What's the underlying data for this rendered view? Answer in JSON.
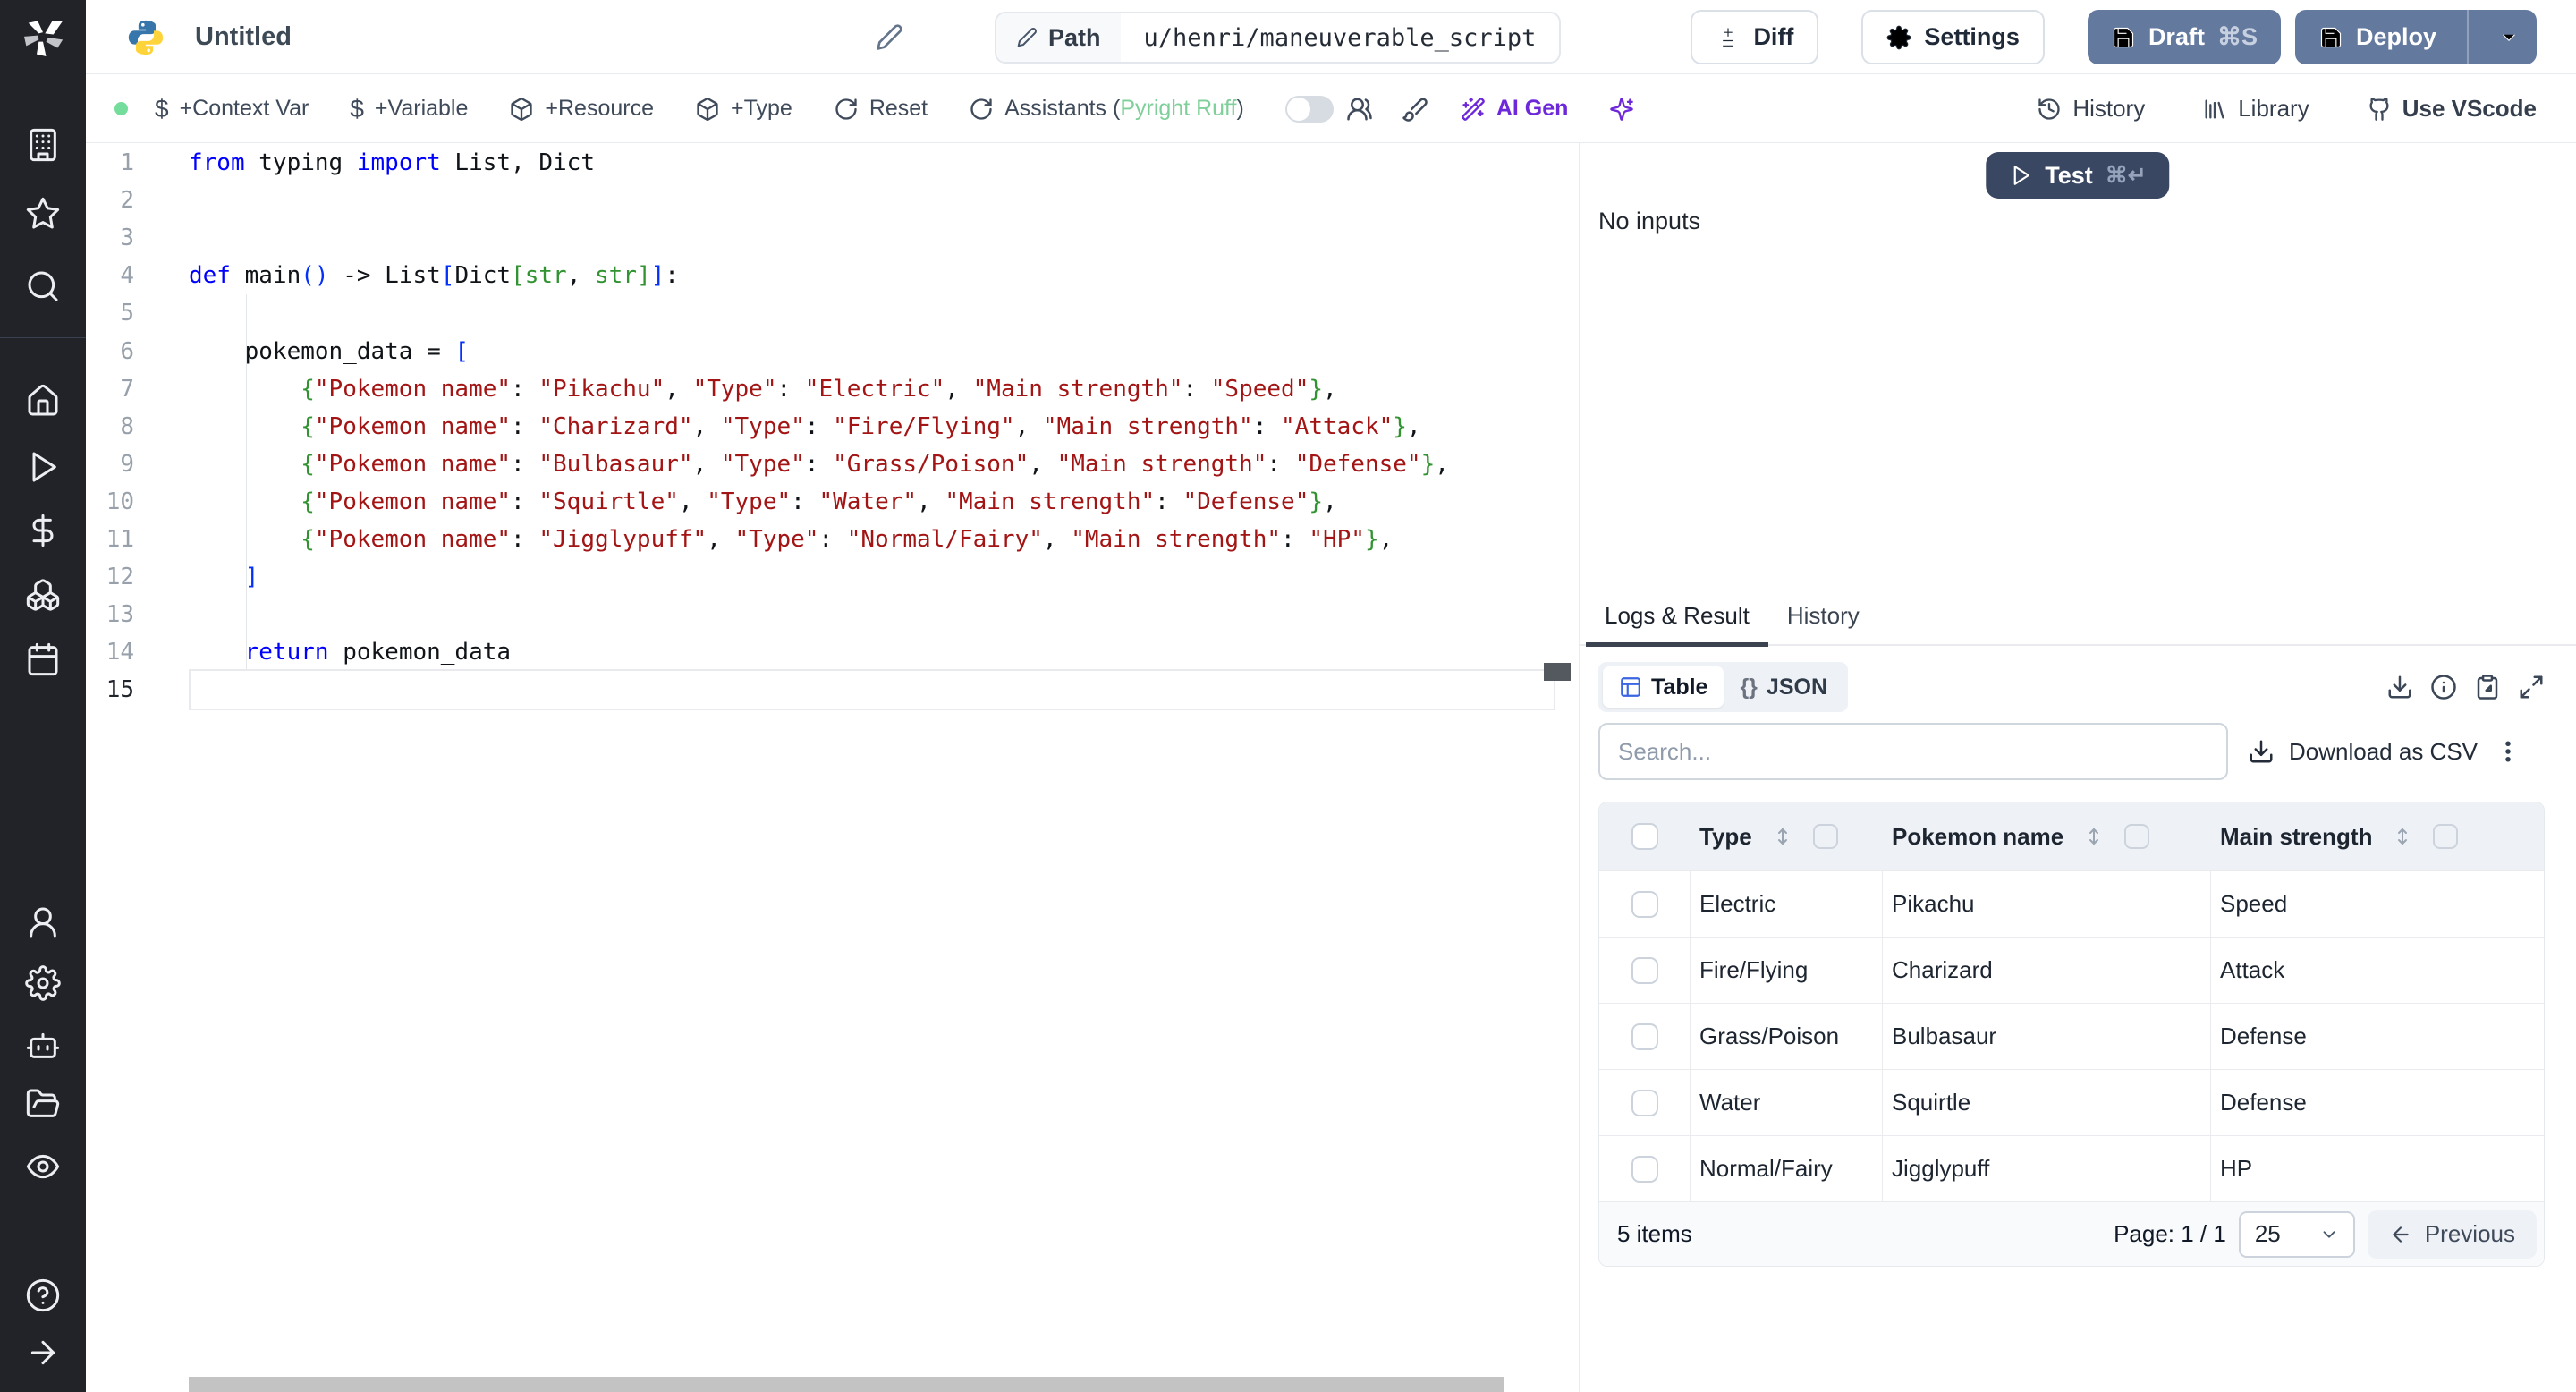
{
  "sidebar": {
    "icons": [
      "windmill-logo",
      "workspace-building",
      "favorites-star",
      "search",
      "home",
      "runs-play",
      "variables-dollar",
      "resources-boxes",
      "schedules-calendar",
      "users-person",
      "settings-gear",
      "workers-robot",
      "folders",
      "audit-eye",
      "help-question",
      "expand-arrow"
    ]
  },
  "topbar": {
    "language_icon": "python",
    "title": "Untitled",
    "path_label": "Path",
    "path_value": "u/henri/maneuverable_script",
    "diff_label": "Diff",
    "settings_label": "Settings",
    "draft_label": "Draft",
    "draft_shortcut": "⌘S",
    "deploy_label": "Deploy"
  },
  "toolbar": {
    "status_color": "#74dd9b",
    "context_var_label": "+Context Var",
    "variable_label": "+Variable",
    "resource_label": "+Resource",
    "type_label": "+Type",
    "reset_label": "Reset",
    "assistants_label": "Assistants",
    "assistants_open": "(",
    "assistants_engines": "Pyright Ruff",
    "assistants_close": ")",
    "ai_gen_label": "AI Gen",
    "history_label": "History",
    "library_label": "Library",
    "vscode_label": "Use VScode"
  },
  "editor": {
    "lines": [
      {
        "n": "1",
        "tokens": [
          [
            "k",
            "from"
          ],
          [
            "p",
            " typing "
          ],
          [
            "k",
            "import"
          ],
          [
            "p",
            " List, Dict"
          ]
        ]
      },
      {
        "n": "2",
        "tokens": []
      },
      {
        "n": "3",
        "tokens": []
      },
      {
        "n": "4",
        "tokens": [
          [
            "k",
            "def"
          ],
          [
            "p",
            " main"
          ],
          [
            "b1",
            "()"
          ],
          [
            "p",
            " -> List"
          ],
          [
            "b1",
            "["
          ],
          [
            "p",
            "Dict"
          ],
          [
            "b2",
            "["
          ],
          [
            "t",
            "str"
          ],
          [
            "p",
            ", "
          ],
          [
            "t",
            "str"
          ],
          [
            "b2",
            "]"
          ],
          [
            "b1",
            "]"
          ],
          [
            "p",
            ":"
          ]
        ]
      },
      {
        "n": "5",
        "tokens": []
      },
      {
        "n": "6",
        "tokens": [
          [
            "p",
            "    pokemon_data = "
          ],
          [
            "b1",
            "["
          ]
        ]
      },
      {
        "n": "7",
        "tokens": [
          [
            "p",
            "        "
          ],
          [
            "b2",
            "{"
          ],
          [
            "s",
            "\"Pokemon name\""
          ],
          [
            "p",
            ": "
          ],
          [
            "s",
            "\"Pikachu\""
          ],
          [
            "p",
            ", "
          ],
          [
            "s",
            "\"Type\""
          ],
          [
            "p",
            ": "
          ],
          [
            "s",
            "\"Electric\""
          ],
          [
            "p",
            ", "
          ],
          [
            "s",
            "\"Main strength\""
          ],
          [
            "p",
            ": "
          ],
          [
            "s",
            "\"Speed\""
          ],
          [
            "b2",
            "}"
          ],
          [
            "p",
            ","
          ]
        ]
      },
      {
        "n": "8",
        "tokens": [
          [
            "p",
            "        "
          ],
          [
            "b2",
            "{"
          ],
          [
            "s",
            "\"Pokemon name\""
          ],
          [
            "p",
            ": "
          ],
          [
            "s",
            "\"Charizard\""
          ],
          [
            "p",
            ", "
          ],
          [
            "s",
            "\"Type\""
          ],
          [
            "p",
            ": "
          ],
          [
            "s",
            "\"Fire/Flying\""
          ],
          [
            "p",
            ", "
          ],
          [
            "s",
            "\"Main strength\""
          ],
          [
            "p",
            ": "
          ],
          [
            "s",
            "\"Attack\""
          ],
          [
            "b2",
            "}"
          ],
          [
            "p",
            ","
          ]
        ]
      },
      {
        "n": "9",
        "tokens": [
          [
            "p",
            "        "
          ],
          [
            "b2",
            "{"
          ],
          [
            "s",
            "\"Pokemon name\""
          ],
          [
            "p",
            ": "
          ],
          [
            "s",
            "\"Bulbasaur\""
          ],
          [
            "p",
            ", "
          ],
          [
            "s",
            "\"Type\""
          ],
          [
            "p",
            ": "
          ],
          [
            "s",
            "\"Grass/Poison\""
          ],
          [
            "p",
            ", "
          ],
          [
            "s",
            "\"Main strength\""
          ],
          [
            "p",
            ": "
          ],
          [
            "s",
            "\"Defense\""
          ],
          [
            "b2",
            "}"
          ],
          [
            "p",
            ","
          ]
        ]
      },
      {
        "n": "10",
        "tokens": [
          [
            "p",
            "        "
          ],
          [
            "b2",
            "{"
          ],
          [
            "s",
            "\"Pokemon name\""
          ],
          [
            "p",
            ": "
          ],
          [
            "s",
            "\"Squirtle\""
          ],
          [
            "p",
            ", "
          ],
          [
            "s",
            "\"Type\""
          ],
          [
            "p",
            ": "
          ],
          [
            "s",
            "\"Water\""
          ],
          [
            "p",
            ", "
          ],
          [
            "s",
            "\"Main strength\""
          ],
          [
            "p",
            ": "
          ],
          [
            "s",
            "\"Defense\""
          ],
          [
            "b2",
            "}"
          ],
          [
            "p",
            ","
          ]
        ]
      },
      {
        "n": "11",
        "tokens": [
          [
            "p",
            "        "
          ],
          [
            "b2",
            "{"
          ],
          [
            "s",
            "\"Pokemon name\""
          ],
          [
            "p",
            ": "
          ],
          [
            "s",
            "\"Jigglypuff\""
          ],
          [
            "p",
            ", "
          ],
          [
            "s",
            "\"Type\""
          ],
          [
            "p",
            ": "
          ],
          [
            "s",
            "\"Normal/Fairy\""
          ],
          [
            "p",
            ", "
          ],
          [
            "s",
            "\"Main strength\""
          ],
          [
            "p",
            ": "
          ],
          [
            "s",
            "\"HP\""
          ],
          [
            "b2",
            "}"
          ],
          [
            "p",
            ","
          ]
        ]
      },
      {
        "n": "12",
        "tokens": [
          [
            "p",
            "    "
          ],
          [
            "b1",
            "]"
          ]
        ]
      },
      {
        "n": "13",
        "tokens": []
      },
      {
        "n": "14",
        "tokens": [
          [
            "p",
            "    "
          ],
          [
            "k",
            "return"
          ],
          [
            "p",
            " pokemon_data"
          ]
        ]
      },
      {
        "n": "15",
        "tokens": [],
        "current": true
      }
    ]
  },
  "run_panel": {
    "test_label": "Test",
    "test_shortcut": "⌘↵",
    "no_inputs": "No inputs"
  },
  "result_panel": {
    "tabs": [
      {
        "label": "Logs & Result",
        "active": true
      },
      {
        "label": "History",
        "active": false
      }
    ],
    "view_toggle": {
      "table_label": "Table",
      "json_icon": "{}",
      "json_label": "JSON"
    },
    "search_placeholder": "Search...",
    "download_csv_label": "Download as CSV",
    "table": {
      "columns": [
        "Type",
        "Pokemon name",
        "Main strength"
      ],
      "rows": [
        [
          "Electric",
          "Pikachu",
          "Speed"
        ],
        [
          "Fire/Flying",
          "Charizard",
          "Attack"
        ],
        [
          "Grass/Poison",
          "Bulbasaur",
          "Defense"
        ],
        [
          "Water",
          "Squirtle",
          "Defense"
        ],
        [
          "Normal/Fairy",
          "Jigglypuff",
          "HP"
        ]
      ]
    },
    "footer": {
      "items_label": "5 items",
      "page_label": "Page: 1 / 1",
      "page_size": "25",
      "previous_label": "Previous"
    }
  },
  "colors": {
    "accent_button": "#64799e",
    "test_button": "#394763",
    "ai_accent": "#6d28d9",
    "assistants_ok": "#7fcf9a",
    "keyword": "#0000ff",
    "string": "#a31515"
  }
}
